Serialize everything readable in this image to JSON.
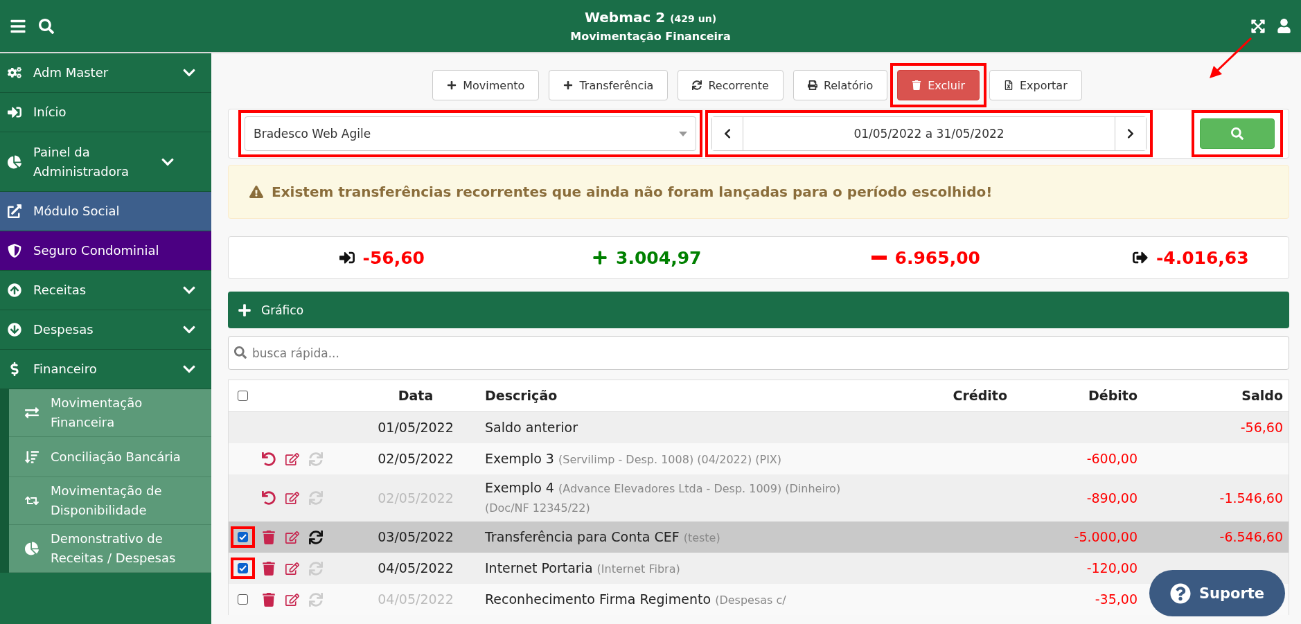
{
  "header": {
    "title": "Webmac 2",
    "count": "(429 un)",
    "subtitle": "Movimentação Financeira"
  },
  "sidebar": {
    "items": [
      {
        "label": "Adm Master",
        "expandable": true,
        "color": "#1b6e47"
      },
      {
        "label": "Início",
        "expandable": false,
        "color": "#1b6e47"
      },
      {
        "label": "Painel da Administradora",
        "expandable": true,
        "color": "#1b6e47"
      },
      {
        "label": "Módulo Social",
        "expandable": false,
        "color": "#3d5f8c"
      },
      {
        "label": "Seguro Condominial",
        "expandable": false,
        "color": "#4b0082"
      },
      {
        "label": "Receitas",
        "expandable": true,
        "color": "#1b6e47"
      },
      {
        "label": "Despesas",
        "expandable": true,
        "color": "#1b6e47"
      },
      {
        "label": "Financeiro",
        "expandable": true,
        "color": "#1b6e47",
        "children": [
          {
            "label": "Movimentação Financeira"
          },
          {
            "label": "Conciliação Bancária"
          },
          {
            "label": "Movimentação de Disponibilidade"
          },
          {
            "label": "Demonstrativo de Receitas / Despesas"
          }
        ]
      }
    ]
  },
  "toolbar": {
    "buttons": [
      {
        "label": "Movimento",
        "kind": "default",
        "highlighted": false
      },
      {
        "label": "Transferência",
        "kind": "default",
        "highlighted": false
      },
      {
        "label": "Recorrente",
        "kind": "default",
        "highlighted": false
      },
      {
        "label": "Relatório",
        "kind": "default",
        "highlighted": false
      },
      {
        "label": "Excluir",
        "kind": "danger",
        "highlighted": true
      },
      {
        "label": "Exportar",
        "kind": "default",
        "highlighted": false
      }
    ]
  },
  "filter": {
    "account": {
      "value": "Bradesco Web Agile",
      "highlighted": true
    },
    "period": {
      "value": "01/05/2022 a 31/05/2022",
      "highlighted": true
    },
    "search_button": {
      "highlighted": true
    }
  },
  "annotation_arrow": true,
  "alert": {
    "text": "Existem transferências recorrentes que ainda não foram lançadas para o período escolhido!"
  },
  "totals": [
    {
      "value": "-56,60",
      "color": "#ff0000"
    },
    {
      "value": "3.004,97",
      "color": "#008000"
    },
    {
      "value": "6.965,00",
      "color": "#ff0000"
    },
    {
      "value": "-4.016,63",
      "color": "#ff0000"
    }
  ],
  "chart_panel": {
    "label": "Gráfico"
  },
  "quick_search": {
    "placeholder": "busca rápida..."
  },
  "table": {
    "columns": [
      "Data",
      "Descrição",
      "Crédito",
      "Débito",
      "Saldo"
    ],
    "select_all_checked": false,
    "rows": [
      {
        "kind": "balance",
        "hovered": false,
        "date": "01/05/2022",
        "date_muted": false,
        "description": "Saldo anterior",
        "saldo": "-56,60"
      },
      {
        "kind": "reversible",
        "hovered": false,
        "sync_active": false,
        "date": "02/05/2022",
        "date_muted": false,
        "description": "Exemplo 3",
        "detail": "(Servilimp - Desp. 1008) (04/2022) (PIX)",
        "debito": "-600,00"
      },
      {
        "kind": "reversible",
        "hovered": false,
        "sync_active": false,
        "date": "02/05/2022",
        "date_muted": true,
        "description": "Exemplo 4",
        "detail": "(Advance Elevadores Ltda - Desp. 1009) (Dinheiro) (Doc/NF 12345/22)",
        "debito": "-890,00",
        "saldo": "-1.546,60"
      },
      {
        "kind": "deletable",
        "checked": true,
        "highlighted": true,
        "hovered": true,
        "sync_active": true,
        "date": "03/05/2022",
        "date_muted": false,
        "description": "Transferência para Conta CEF",
        "detail": "(teste)",
        "debito": "-5.000,00",
        "saldo": "-6.546,60"
      },
      {
        "kind": "deletable",
        "checked": true,
        "highlighted": true,
        "hovered": false,
        "sync_active": false,
        "date": "04/05/2022",
        "date_muted": false,
        "description": "Internet Portaria",
        "detail": "(Internet Fibra)",
        "debito": "-120,00"
      },
      {
        "kind": "deletable",
        "checked": false,
        "highlighted": false,
        "hovered": false,
        "sync_active": false,
        "date": "04/05/2022",
        "date_muted": true,
        "description": "Reconhecimento Firma Regimento",
        "detail": "(Despesas c/",
        "debito": "-35,00"
      }
    ]
  },
  "support_button": {
    "label": "Suporte"
  }
}
